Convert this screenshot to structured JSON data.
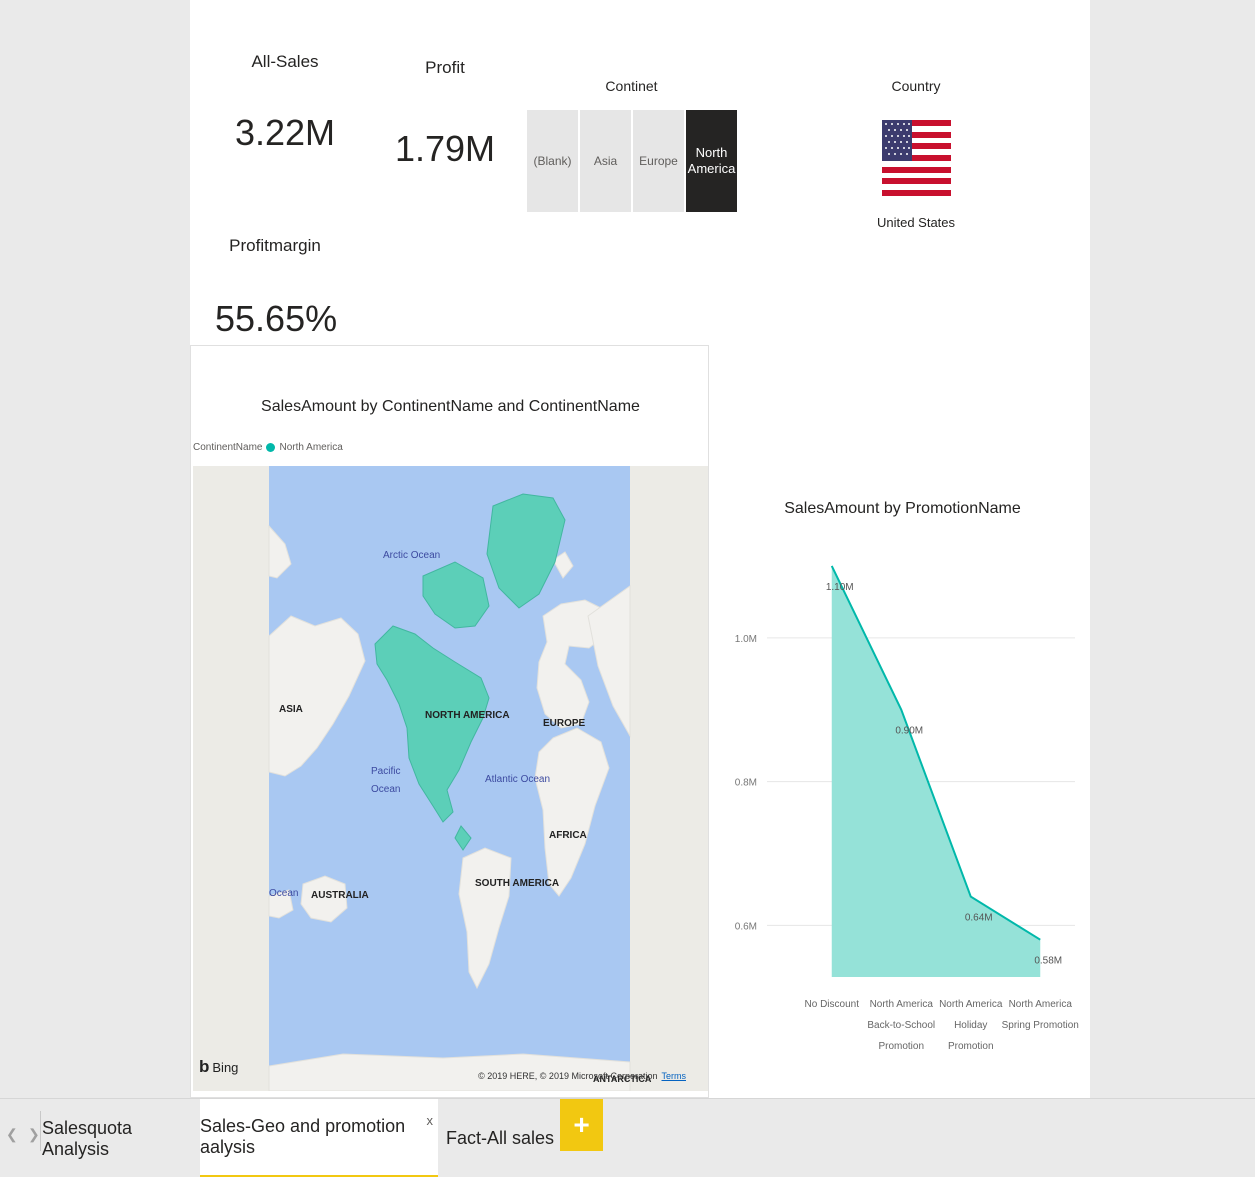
{
  "cards": {
    "all_sales": {
      "label": "All-Sales",
      "value": "3.22M"
    },
    "profit": {
      "label": "Profit",
      "value": "1.79M"
    },
    "profit_margin": {
      "label": "Profitmargin",
      "value": "55.65%"
    }
  },
  "continent_slicer": {
    "title": "Continet",
    "options": [
      "(Blank)",
      "Asia",
      "Europe",
      "North America"
    ],
    "selected": "North America"
  },
  "country": {
    "title": "Country",
    "value": "United States"
  },
  "map": {
    "title": "SalesAmount by ContinentName and ContinentName",
    "legend_label": "ContinentName",
    "legend_item": "North America",
    "highlight_color": "#5ccfb8",
    "labels": {
      "arctic": "Arctic Ocean",
      "asia": "ASIA",
      "north_america": "NORTH AMERICA",
      "europe": "EUROPE",
      "pacific_1": "Pacific",
      "pacific_2": "Ocean",
      "atlantic": "Atlantic Ocean",
      "africa": "AFRICA",
      "ocean": "Ocean",
      "australia": "AUSTRALIA",
      "south_america": "SOUTH AMERICA",
      "antarctica": "ANTARCTICA"
    },
    "bing_label": "Bing",
    "copyright": "© 2019 HERE, © 2019 Microsoft Corporation",
    "terms": "Terms"
  },
  "area_chart_title": "SalesAmount by PromotionName",
  "chart_data": {
    "type": "area",
    "title": "SalesAmount by PromotionName",
    "categories": [
      [
        "No Discount"
      ],
      [
        "North America",
        "Back-to-School",
        "Promotion"
      ],
      [
        "North America",
        "Holiday",
        "Promotion"
      ],
      [
        "North America",
        "Spring Promotion"
      ]
    ],
    "values": [
      1.1,
      0.9,
      0.64,
      0.58
    ],
    "data_labels": [
      "1.10M",
      "0.90M",
      "0.64M",
      "0.58M"
    ],
    "yticks": [
      0.6,
      0.8,
      1.0
    ],
    "ytick_labels": [
      "0.6M",
      "0.8M",
      "1.0M"
    ],
    "ylim": [
      0.51,
      1.15
    ],
    "grid": true,
    "color": "#01b8aa",
    "fill_color": "#95e2d8"
  },
  "tabs": {
    "items": [
      {
        "label": "Salesquota Analysis"
      },
      {
        "label": "Sales-Geo and promotion aalysis",
        "active": true,
        "close": "x"
      },
      {
        "label": "Fact-All sales"
      }
    ],
    "add_label": "+"
  }
}
